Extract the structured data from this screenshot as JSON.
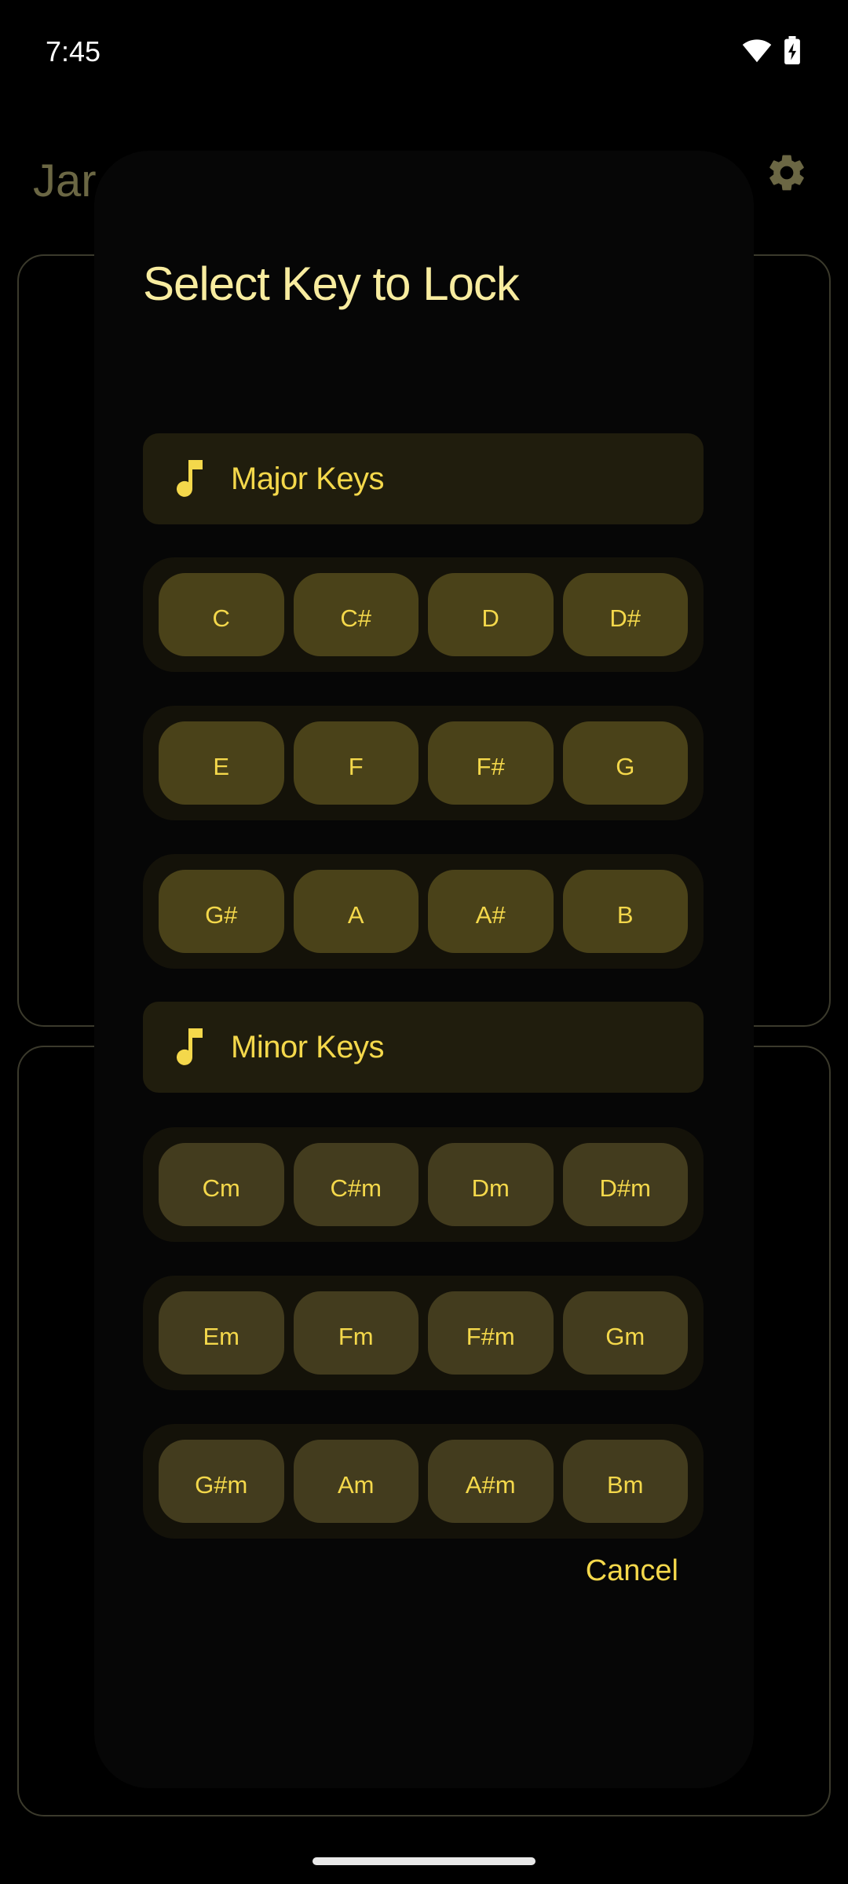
{
  "status_bar": {
    "time": "7:45",
    "icons": [
      "wifi-icon",
      "battery-charging-icon"
    ]
  },
  "background_app": {
    "title": "Jar",
    "settings_icon": "gear-icon"
  },
  "dialog": {
    "title": "Select Key to Lock",
    "major": {
      "label": "Major Keys",
      "icon": "music-note-icon",
      "rows": [
        [
          "C",
          "C#",
          "D",
          "D#"
        ],
        [
          "E",
          "F",
          "F#",
          "G"
        ],
        [
          "G#",
          "A",
          "A#",
          "B"
        ]
      ]
    },
    "minor": {
      "label": "Minor Keys",
      "icon": "music-note-icon",
      "rows": [
        [
          "Cm",
          "C#m",
          "Dm",
          "D#m"
        ],
        [
          "Em",
          "Fm",
          "F#m",
          "Gm"
        ],
        [
          "G#m",
          "Am",
          "A#m",
          "Bm"
        ]
      ]
    },
    "cancel_label": "Cancel"
  },
  "colors": {
    "accent": "#f4d84b",
    "title": "#f8ec9f",
    "key_button": "#4a4219",
    "row_background": "#141209",
    "header_background": "#201d0d",
    "dialog_background": "#060606"
  }
}
